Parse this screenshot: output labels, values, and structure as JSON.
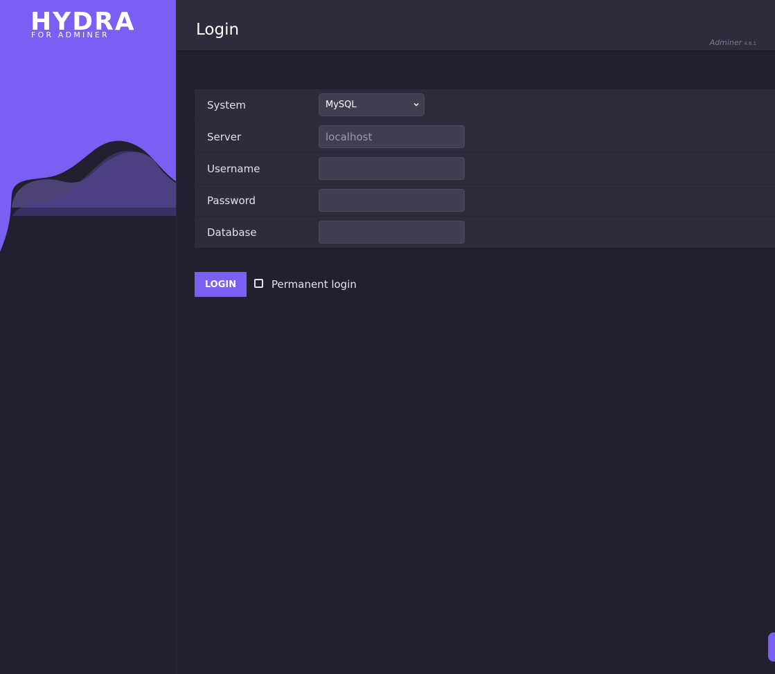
{
  "brand": {
    "title": "HYDRA",
    "subtitle": "FOR ADMINER",
    "accent": "#7a5ff2"
  },
  "header": {
    "title": "Login",
    "app_name": "Adminer",
    "version": "4.8.1"
  },
  "form": {
    "system": {
      "label": "System",
      "value": "MySQL",
      "icon": "chevron-down-icon"
    },
    "server": {
      "label": "Server",
      "value": "",
      "placeholder": "localhost"
    },
    "username": {
      "label": "Username",
      "value": ""
    },
    "password": {
      "label": "Password",
      "value": ""
    },
    "database": {
      "label": "Database",
      "value": ""
    }
  },
  "actions": {
    "login_label": "LOGIN",
    "permanent_login_label": "Permanent login",
    "permanent_login_checked": false
  }
}
